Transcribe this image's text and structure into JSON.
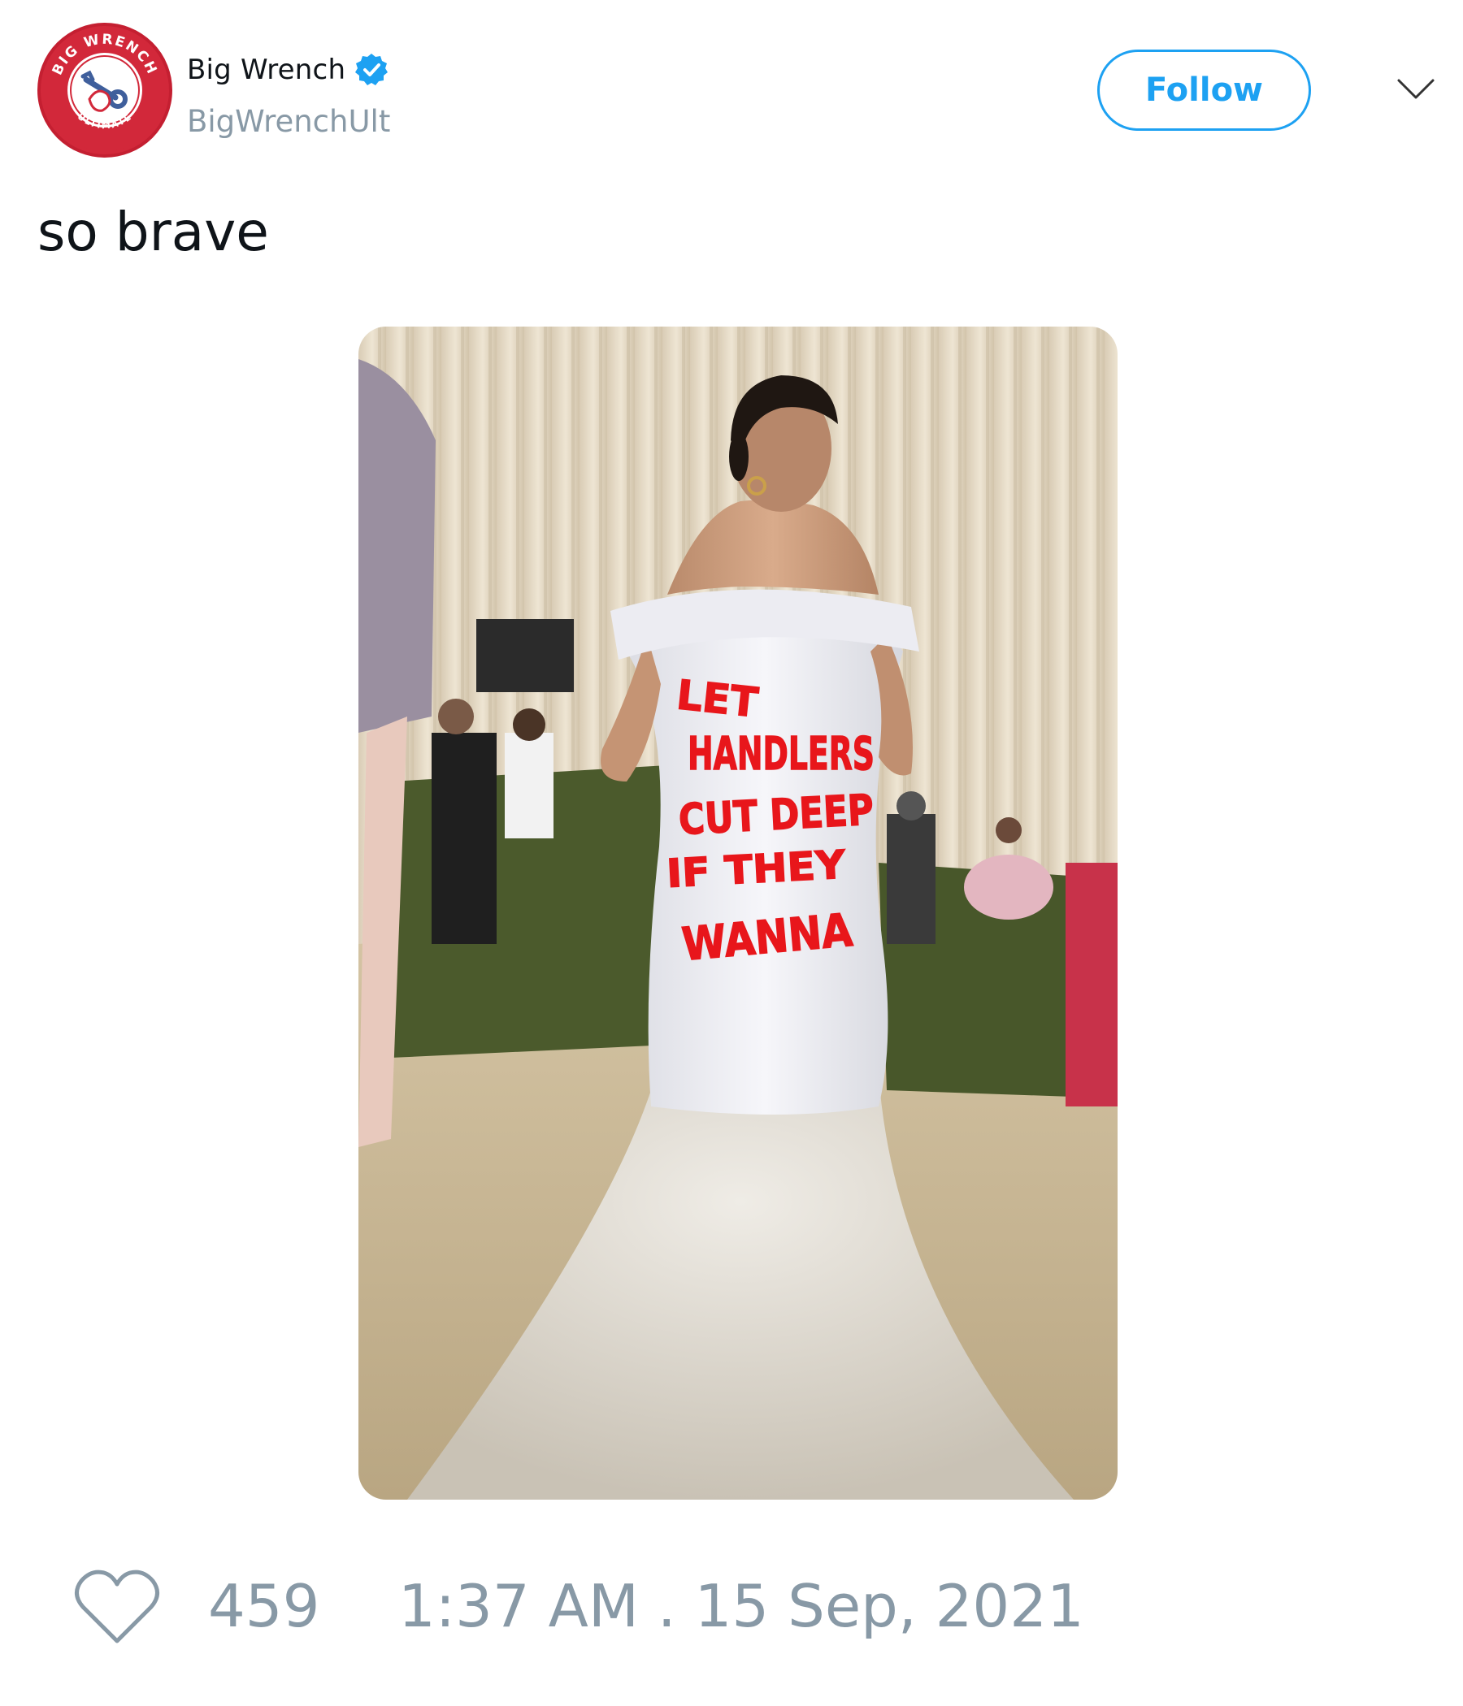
{
  "author": {
    "display_name": "Big Wrench",
    "handle": "BigWrenchUlt",
    "verified": true,
    "avatar_text_top": "BIG WRENCH",
    "avatar_text_bottom": "ULTIMATE"
  },
  "header": {
    "follow_label": "Follow",
    "menu_icon": "chevron-down-icon"
  },
  "tweet": {
    "text": "so brave",
    "media_text": [
      "LET",
      "HANDLERS",
      "CUT DEEP",
      "IF THEY",
      "WANNA"
    ]
  },
  "footer": {
    "like_icon": "heart-icon",
    "like_count": "459",
    "timestamp": "1:37 AM . 15 Sep, 2021"
  },
  "colors": {
    "accent": "#1da1f2",
    "muted": "#8899a6",
    "brand_red": "#d2283a",
    "media_annotation": "#e8161b"
  }
}
